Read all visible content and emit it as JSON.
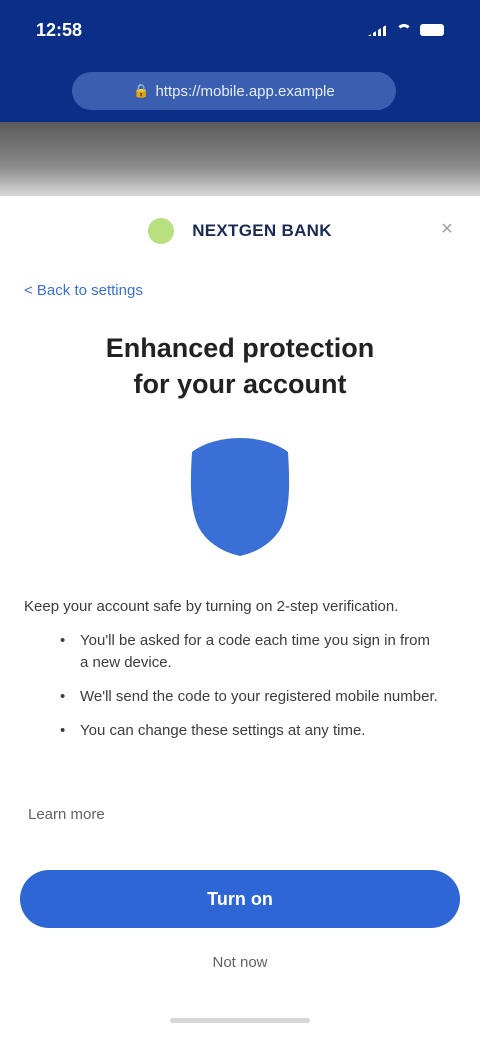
{
  "status_bar": {
    "time": "12:58",
    "battery": "84"
  },
  "browser": {
    "url": "https://mobile.app.example"
  },
  "tabs": [
    {
      "label": ""
    },
    {
      "label": ""
    }
  ],
  "header": {
    "brand": "NEXTGEN BANK"
  },
  "back_link": "< Back to settings",
  "title_line1": "Enhanced protection",
  "title_line2": "for your account",
  "intro": "Keep your account safe by turning on 2-step verification.",
  "bullets": [
    "You'll be asked for a code each time you sign in from a new device.",
    "We'll send the code to your registered mobile number.",
    "You can change these settings at any time."
  ],
  "secondary_link": "Learn more",
  "primary_button": "Turn on",
  "skip": "Not now",
  "colors": {
    "primary": "#2f66d6",
    "header_blue": "#0b2f86",
    "accent_green": "#b7e07e"
  }
}
